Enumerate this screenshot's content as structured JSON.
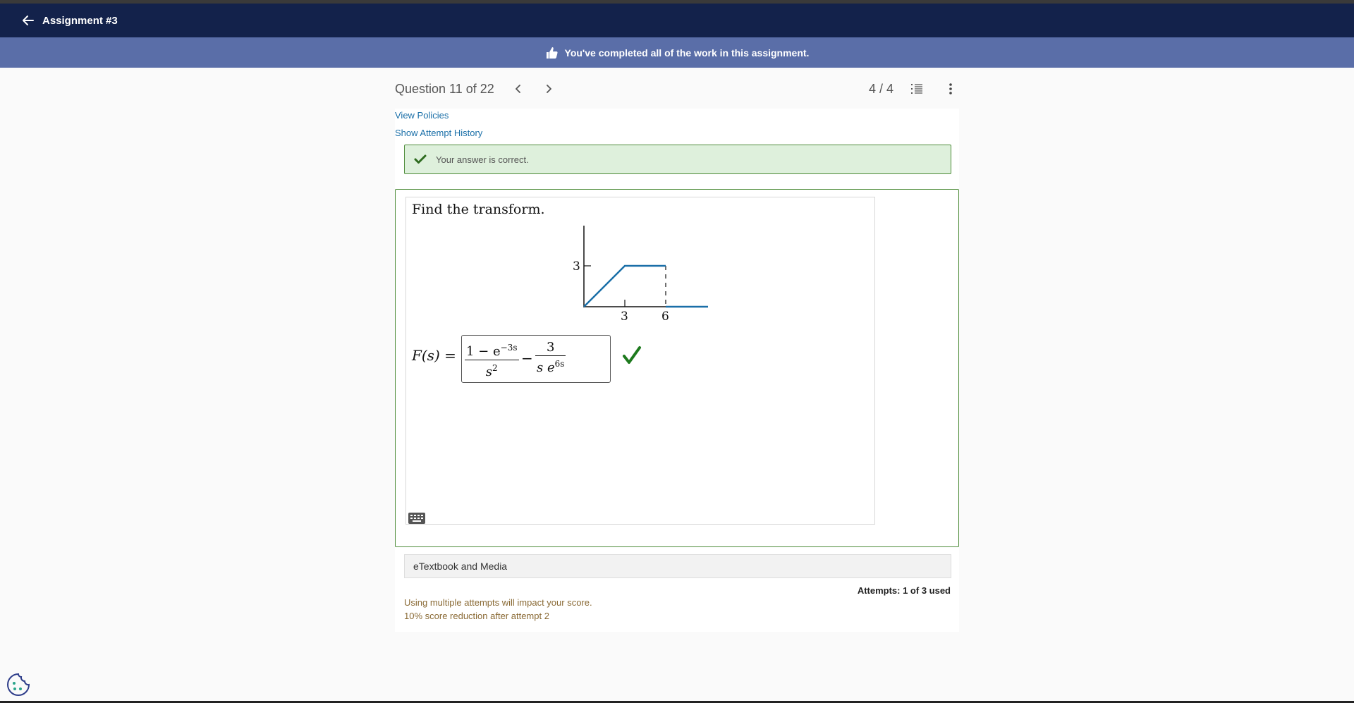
{
  "header": {
    "back_icon": "arrow-left-icon",
    "title": "Assignment #3",
    "background": "#13224b"
  },
  "banner": {
    "icon": "thumbs-up-icon",
    "message": "You've completed all of the work in this assignment.",
    "background": "#5a6ea8"
  },
  "question_nav": {
    "label": "Question 11 of 22",
    "prev_icon": "chevron-left-icon",
    "next_icon": "chevron-right-icon",
    "score": "4 / 4",
    "list_icon": "question-list-icon",
    "more_icon": "more-vertical-icon"
  },
  "links": {
    "view_policies": "View Policies",
    "attempt_history": "Show Attempt History"
  },
  "feedback": {
    "icon": "checkmark-icon",
    "text": "Your answer is correct.",
    "color": "#4e8c3a"
  },
  "question": {
    "prompt": "Find the transform.",
    "graph": {
      "y_tick_label": "3",
      "x_tick_labels": [
        "3",
        "6"
      ],
      "line_color": "#1a6fa8"
    },
    "answer_label": "F(s)",
    "answer_equals": "=",
    "answer": {
      "term1_numerator_base": "1 − e",
      "term1_numerator_exp": "−3s",
      "term1_denominator_base": "s",
      "term1_denominator_exp": "2",
      "operator": "−",
      "term2_numerator": "3",
      "term2_denominator_base": "s e",
      "term2_denominator_exp": "6s"
    },
    "answer_status_icon": "green-checkmark-icon",
    "keyboard_icon": "keyboard-icon"
  },
  "resources": {
    "etextbook_label": "eTextbook and Media"
  },
  "attempts": {
    "label": "Attempts: 1 of 3 used",
    "note_line1": "Using multiple attempts will impact your score.",
    "note_line2": "10% score reduction after attempt 2"
  },
  "cookie_icon": "cookie-settings-icon"
}
